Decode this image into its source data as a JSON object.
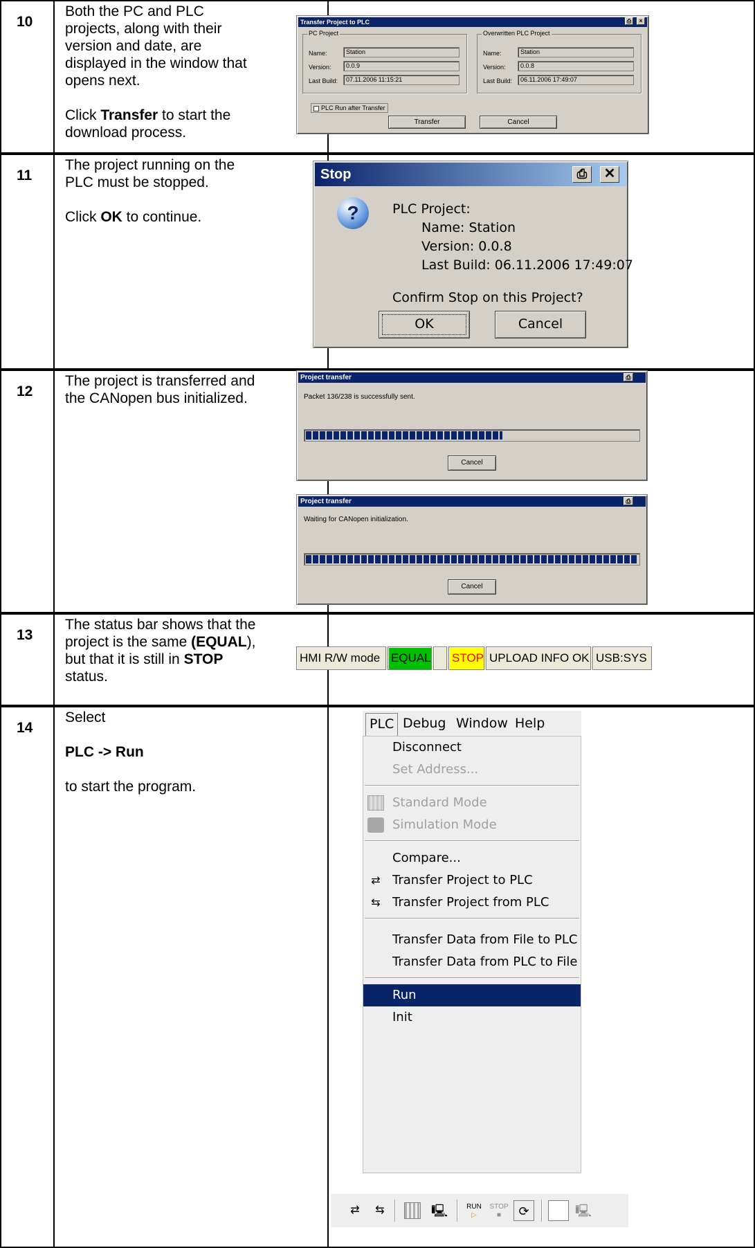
{
  "steps": [
    {
      "number": "10",
      "lines": [
        "Both the PC and PLC",
        "projects, along with their",
        "version and date, are",
        "displayed in the window that",
        "opens next."
      ],
      "action_prefix": "Click ",
      "action_bold": "Transfer",
      "action_suffix": " to start the",
      "action_line2": "download process."
    },
    {
      "number": "11",
      "lines": [
        "The project running on the",
        "PLC must be stopped."
      ],
      "action_prefix": "Click ",
      "action_bold": "OK",
      "action_suffix": " to continue."
    },
    {
      "number": "12",
      "lines": [
        "The project is transferred and",
        "the CANopen bus initialized."
      ]
    },
    {
      "number": "13",
      "line1": "The status bar shows that the",
      "line2_prefix": "project is the same ",
      "line2_bold": "(EQUAL",
      "line2_suffix": "),",
      "line3_prefix": "but that it is still in ",
      "line3_bold": "STOP",
      "line4": "status."
    },
    {
      "number": "14",
      "line1": "Select",
      "bold_line": "PLC -> Run",
      "line3": " to start the program."
    }
  ],
  "transfer_dialog": {
    "title": "Transfer Project to PLC",
    "pc_group": "PC Project",
    "plc_group": "Overwritten PLC Project",
    "name_label": "Name:",
    "version_label": "Version:",
    "lastbuild_label": "Last Build:",
    "pc_name": "Station",
    "pc_version": "0.0.9",
    "pc_lastbuild": "07.11.2006 11:15:21",
    "plc_name": "Station",
    "plc_version": "0.0.8",
    "plc_lastbuild": "06.11.2006 17:49:07",
    "checkbox_label": "PLC Run after Transfer",
    "transfer_button": "Transfer",
    "cancel_button": "Cancel"
  },
  "stop_dialog": {
    "title": "Stop",
    "line1": "PLC Project:",
    "line2": "Name:  Station",
    "line3": "Version:  0.0.8",
    "line4": "Last Build:   06.11.2006 17:49:07",
    "question": "Confirm Stop on this Project?",
    "ok_button": "OK",
    "cancel_button": "Cancel"
  },
  "progress_dialogs": [
    {
      "title": "Project transfer",
      "message": "Packet 136/238 is successfully sent.",
      "progress": 0.57,
      "cancel_button": "Cancel"
    },
    {
      "title": "Project transfer",
      "message": "Waiting for CANopen initialization.",
      "progress": 1.0,
      "cancel_button": "Cancel"
    }
  ],
  "status_bar": {
    "mode": "HMI R/W mode",
    "compare": "EQUAL",
    "empty": "",
    "state": "STOP",
    "upload": "UPLOAD INFO OK",
    "connection": "USB:SYS",
    "colors": {
      "equal_bg": "#00c000",
      "stop_bg": "#ffff00",
      "stop_text": "#ff0000"
    }
  },
  "menu": {
    "bar": [
      "PLC",
      "Debug",
      "Window",
      "Help"
    ],
    "items": [
      {
        "label": "Disconnect",
        "state": "enabled",
        "icon": ""
      },
      {
        "label": "Set Address...",
        "state": "disabled",
        "icon": ""
      },
      {
        "label": "Standard Mode",
        "state": "disabled",
        "icon": "standard-mode-icon"
      },
      {
        "label": "Simulation Mode",
        "state": "disabled",
        "icon": "simulation-mode-icon"
      },
      {
        "label": "Compare...",
        "state": "enabled",
        "icon": ""
      },
      {
        "label": "Transfer Project to PLC",
        "state": "enabled",
        "icon": "transfer-to-plc-icon"
      },
      {
        "label": "Transfer Project from PLC",
        "state": "enabled",
        "icon": "transfer-from-plc-icon"
      },
      {
        "label": "Transfer Data from File to PLC",
        "state": "enabled",
        "icon": ""
      },
      {
        "label": "Transfer Data from PLC to File",
        "state": "enabled",
        "icon": ""
      },
      {
        "label": "Run",
        "state": "selected",
        "icon": ""
      },
      {
        "label": "Init",
        "state": "enabled",
        "icon": ""
      }
    ]
  },
  "toolbar": {
    "run_label": "RUN",
    "stop_label": "STOP"
  }
}
